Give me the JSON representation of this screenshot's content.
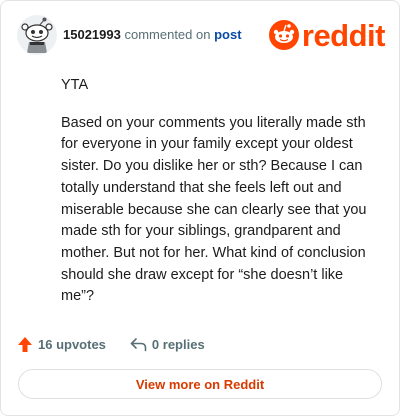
{
  "header": {
    "username": "15021993",
    "action_text": "commented on",
    "post_link": "post",
    "brand_name": "reddit"
  },
  "comment": {
    "paragraphs": [
      "YTA",
      "Based on your comments you literally made sth for everyone in your family except your oldest sister. Do you dislike her or sth? Because I can totally understand that she feels left out and miserable because she can clearly see that you made sth for your siblings, grandparent and mother. But not for her. What kind of conclusion should she draw except for “she doesn’t like me”?"
    ]
  },
  "footer": {
    "upvotes_label": "16 upvotes",
    "replies_label": "0 replies",
    "view_more_label": "View more on Reddit"
  },
  "colors": {
    "brand": "#ff4500",
    "link": "#0a4ba3",
    "button_text": "#d93a00"
  },
  "icons": [
    "avatar-snoo",
    "reddit-logo-icon",
    "upvote-arrow-icon",
    "reply-icon"
  ]
}
